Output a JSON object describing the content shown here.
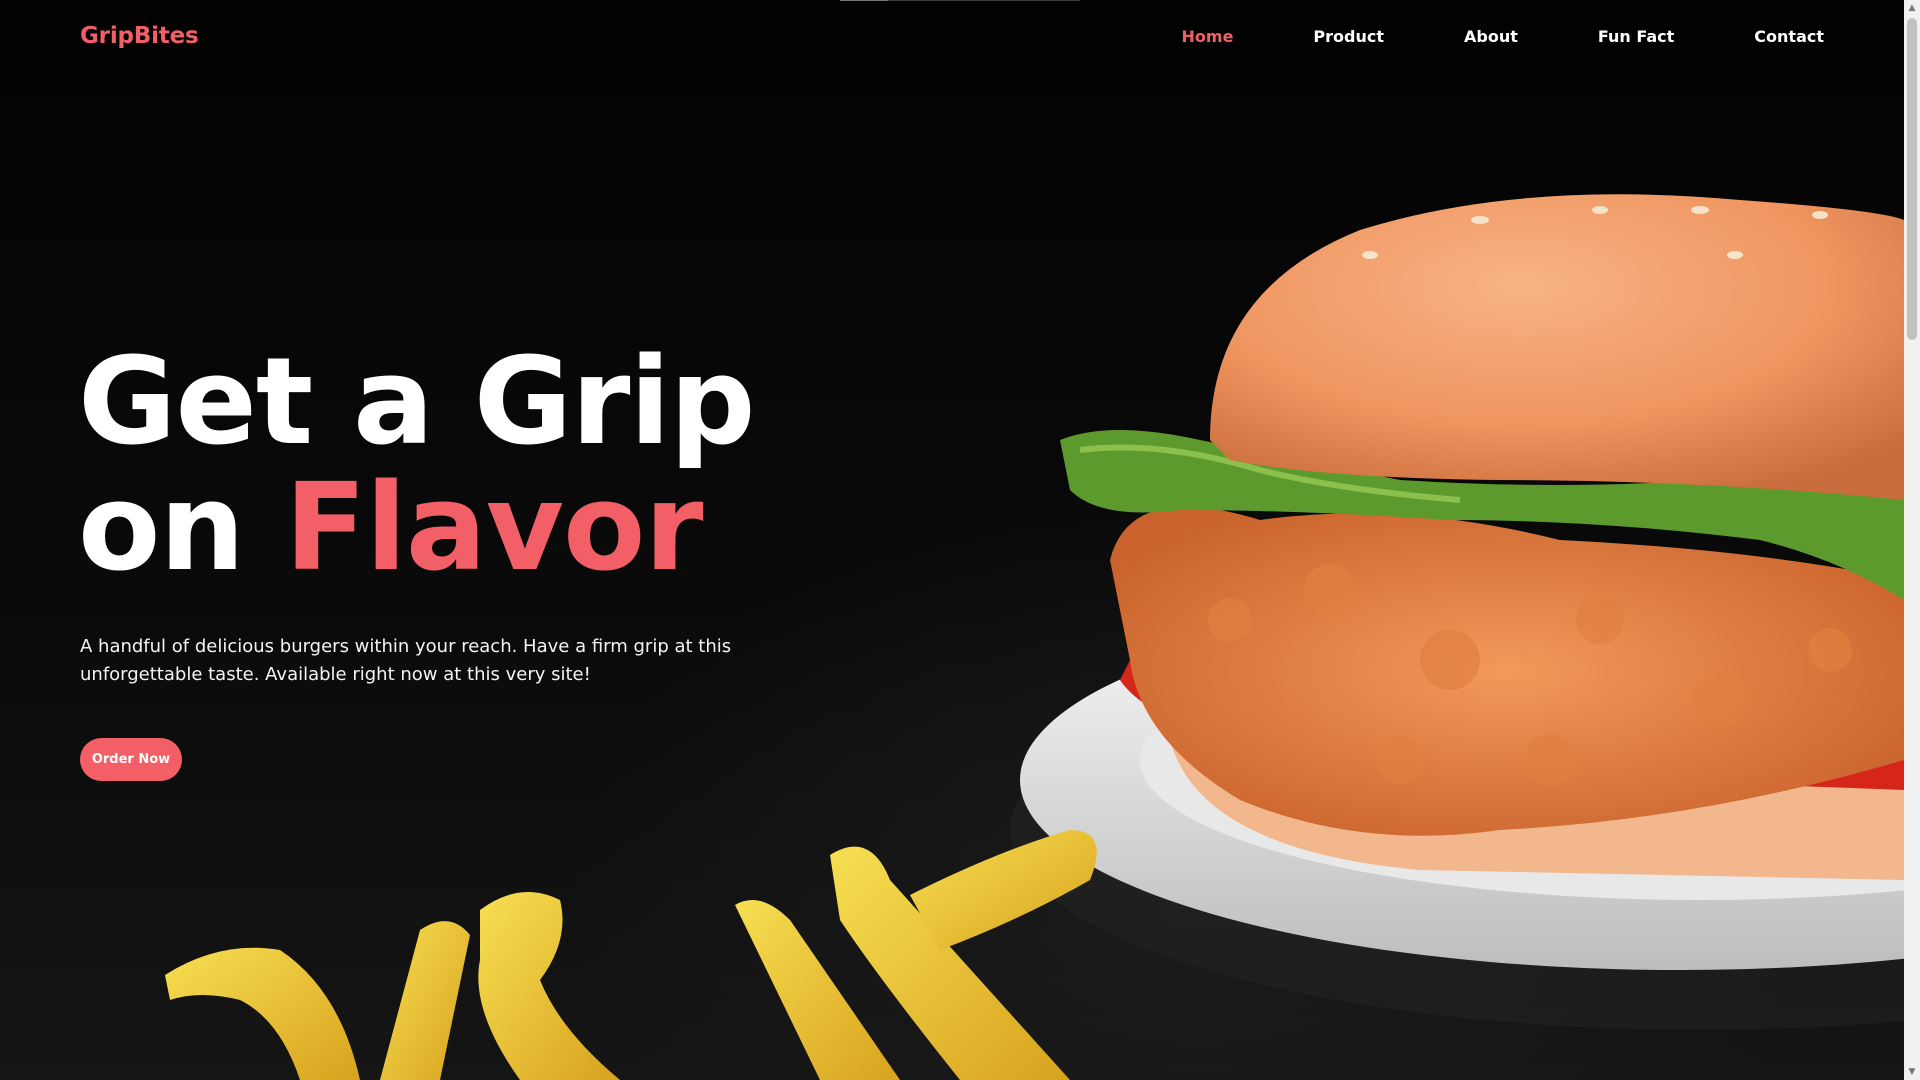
{
  "brand": {
    "name": "GripBites",
    "accent_color": "#f25f66"
  },
  "nav": {
    "items": [
      {
        "label": "Home",
        "active": true
      },
      {
        "label": "Product",
        "active": false
      },
      {
        "label": "About",
        "active": false
      },
      {
        "label": "Fun Fact",
        "active": false
      },
      {
        "label": "Contact",
        "active": false
      }
    ]
  },
  "hero": {
    "title_line1": "Get a Grip",
    "title_line2_prefix": "on",
    "title_line2_accent": "Flavor",
    "description": "A handful of delicious burgers within your reach. Have a firm grip at this unforgettable taste. Available right now at this very site!",
    "cta_label": "Order Now"
  },
  "image": {
    "subject": "burger-with-fries"
  },
  "scrollbar": {
    "up_icon": "scroll-up-arrow-icon",
    "down_icon": "scroll-down-arrow-icon"
  }
}
